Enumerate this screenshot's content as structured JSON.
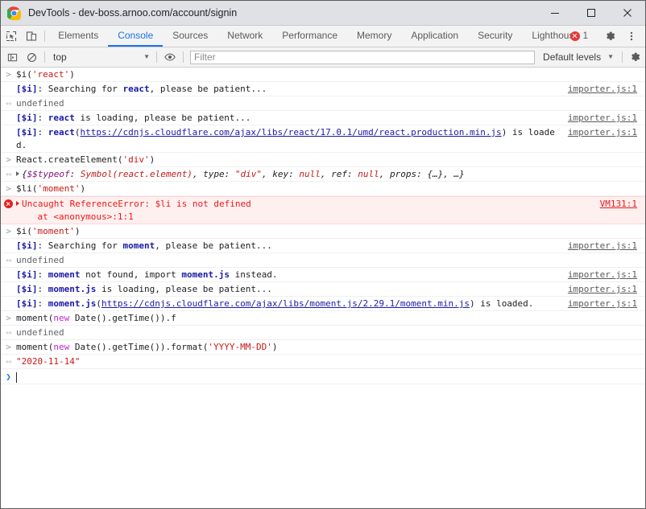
{
  "window": {
    "title": "DevTools - dev-boss.arnoo.com/account/signin",
    "logo_icon": "chrome-logo",
    "controls": [
      {
        "name": "minimize",
        "icon": "minimize-icon"
      },
      {
        "name": "maximize",
        "icon": "maximize-icon"
      },
      {
        "name": "close",
        "icon": "close-icon"
      }
    ]
  },
  "tabbar": {
    "left_icons": [
      {
        "name": "inspect-element-picker",
        "icon": "cursor-select-icon"
      },
      {
        "name": "device-toolbar-toggle",
        "icon": "device-toggle-icon"
      }
    ],
    "tabs": [
      {
        "label": "Elements",
        "active": false
      },
      {
        "label": "Console",
        "active": true
      },
      {
        "label": "Sources",
        "active": false
      },
      {
        "label": "Network",
        "active": false
      },
      {
        "label": "Performance",
        "active": false
      },
      {
        "label": "Memory",
        "active": false
      },
      {
        "label": "Application",
        "active": false
      },
      {
        "label": "Security",
        "active": false
      },
      {
        "label": "Lighthouse",
        "active": false
      }
    ],
    "error_count": "1",
    "error_icon": "error-circle-icon",
    "settings_icon": "gear-icon",
    "more_icon": "more-vertical-icon"
  },
  "console_toolbar": {
    "sidebar_toggle_icon": "console-sidebar-icon",
    "clear_icon": "clear-console-icon",
    "context_value": "top",
    "eye_icon": "live-expression-eye-icon",
    "filter_placeholder": "Filter",
    "filter_value": "",
    "levels_label": "Default levels",
    "settings_icon": "gear-icon"
  },
  "console_rows": [
    {
      "id": "r1",
      "kind": "input",
      "gutter": ">",
      "source": "",
      "tokens": [
        {
          "t": "plain",
          "v": "$i("
        },
        {
          "t": "str",
          "v": "'react'"
        },
        {
          "t": "plain",
          "v": ")"
        }
      ]
    },
    {
      "id": "r2",
      "kind": "log",
      "gutter": "",
      "source": "importer.js:1",
      "tokens": [
        {
          "t": "tag",
          "v": "[$i]"
        },
        {
          "t": "plain",
          "v": ": Searching for "
        },
        {
          "t": "tag",
          "v": "react"
        },
        {
          "t": "plain",
          "v": ", please be patient..."
        }
      ]
    },
    {
      "id": "r3",
      "kind": "output",
      "gutter": "↤",
      "source": "",
      "tokens": [
        {
          "t": "undef",
          "v": "undefined"
        }
      ]
    },
    {
      "id": "r4",
      "kind": "log",
      "gutter": "",
      "source": "importer.js:1",
      "tokens": [
        {
          "t": "tag",
          "v": "[$i]"
        },
        {
          "t": "plain",
          "v": ": "
        },
        {
          "t": "tag",
          "v": "react"
        },
        {
          "t": "plain",
          "v": " is loading, please be patient..."
        }
      ]
    },
    {
      "id": "r5",
      "kind": "log",
      "gutter": "",
      "source": "importer.js:1",
      "tokens": [
        {
          "t": "tag",
          "v": "[$i]"
        },
        {
          "t": "plain",
          "v": ": "
        },
        {
          "t": "tag",
          "v": "react"
        },
        {
          "t": "plain",
          "v": "("
        },
        {
          "t": "link",
          "v": "https://cdnjs.cloudflare.com/ajax/libs/react/17.0.1/umd/react.production.min.js"
        },
        {
          "t": "plain",
          "v": ") is loaded."
        }
      ]
    },
    {
      "id": "r6",
      "kind": "input",
      "gutter": ">",
      "source": "",
      "tokens": [
        {
          "t": "plain",
          "v": "React.createElement("
        },
        {
          "t": "str",
          "v": "'div'"
        },
        {
          "t": "plain",
          "v": ")"
        }
      ]
    },
    {
      "id": "r7",
      "kind": "output",
      "gutter": "↤",
      "source": "",
      "expandable": true,
      "tokens": [
        {
          "t": "objname",
          "v": "{"
        },
        {
          "t": "objkey",
          "v": "$$typeof"
        },
        {
          "t": "objname",
          "v": ": "
        },
        {
          "t": "objval",
          "v": "Symbol(react.element)"
        },
        {
          "t": "objname",
          "v": ", type: "
        },
        {
          "t": "objval",
          "v": "\"div\""
        },
        {
          "t": "objname",
          "v": ", key: "
        },
        {
          "t": "objval",
          "v": "null"
        },
        {
          "t": "objname",
          "v": ", ref: "
        },
        {
          "t": "objval",
          "v": "null"
        },
        {
          "t": "objname",
          "v": ", props: {…}, …}"
        }
      ]
    },
    {
      "id": "r8",
      "kind": "input",
      "gutter": ">",
      "source": "",
      "tokens": [
        {
          "t": "plain",
          "v": "$li("
        },
        {
          "t": "str",
          "v": "'moment'"
        },
        {
          "t": "plain",
          "v": ")"
        }
      ]
    },
    {
      "id": "r9",
      "kind": "error",
      "gutter": "error-icon",
      "source": "VM131:1",
      "expandable": true,
      "text": "Uncaught ReferenceError: $li is not defined",
      "text2": "    at <anonymous>:1:1"
    },
    {
      "id": "r10",
      "kind": "input",
      "gutter": ">",
      "source": "",
      "tokens": [
        {
          "t": "plain",
          "v": "$i("
        },
        {
          "t": "str",
          "v": "'moment'"
        },
        {
          "t": "plain",
          "v": ")"
        }
      ]
    },
    {
      "id": "r11",
      "kind": "log",
      "gutter": "",
      "source": "importer.js:1",
      "tokens": [
        {
          "t": "tag",
          "v": "[$i]"
        },
        {
          "t": "plain",
          "v": ": Searching for "
        },
        {
          "t": "tag",
          "v": "moment"
        },
        {
          "t": "plain",
          "v": ", please be patient..."
        }
      ]
    },
    {
      "id": "r12",
      "kind": "output",
      "gutter": "↤",
      "source": "",
      "tokens": [
        {
          "t": "undef",
          "v": "undefined"
        }
      ]
    },
    {
      "id": "r13",
      "kind": "log",
      "gutter": "",
      "source": "importer.js:1",
      "tokens": [
        {
          "t": "tag",
          "v": "[$i]"
        },
        {
          "t": "plain",
          "v": ": "
        },
        {
          "t": "tag",
          "v": "moment"
        },
        {
          "t": "plain",
          "v": " not found, import "
        },
        {
          "t": "tag",
          "v": "moment.js"
        },
        {
          "t": "plain",
          "v": " instead."
        }
      ]
    },
    {
      "id": "r14",
      "kind": "log",
      "gutter": "",
      "source": "importer.js:1",
      "tokens": [
        {
          "t": "tag",
          "v": "[$i]"
        },
        {
          "t": "plain",
          "v": ": "
        },
        {
          "t": "tag",
          "v": "moment.js"
        },
        {
          "t": "plain",
          "v": " is loading, please be patient..."
        }
      ]
    },
    {
      "id": "r15",
      "kind": "log",
      "gutter": "",
      "source": "importer.js:1",
      "tokens": [
        {
          "t": "tag",
          "v": "[$i]"
        },
        {
          "t": "plain",
          "v": ": "
        },
        {
          "t": "tag",
          "v": "moment.js"
        },
        {
          "t": "plain",
          "v": "("
        },
        {
          "t": "link",
          "v": "https://cdnjs.cloudflare.com/ajax/libs/moment.js/2.29.1/moment.min.js"
        },
        {
          "t": "plain",
          "v": ") is loaded."
        }
      ]
    },
    {
      "id": "r16",
      "kind": "input",
      "gutter": ">",
      "source": "",
      "tokens": [
        {
          "t": "plain",
          "v": "moment("
        },
        {
          "t": "kwnew",
          "v": "new"
        },
        {
          "t": "plain",
          "v": " Date().getTime()).f"
        }
      ]
    },
    {
      "id": "r17",
      "kind": "output",
      "gutter": "↤",
      "source": "",
      "tokens": [
        {
          "t": "undef",
          "v": "undefined"
        }
      ]
    },
    {
      "id": "r18",
      "kind": "input",
      "gutter": ">",
      "source": "",
      "tokens": [
        {
          "t": "plain",
          "v": "moment("
        },
        {
          "t": "kwnew",
          "v": "new"
        },
        {
          "t": "plain",
          "v": " Date().getTime()).format("
        },
        {
          "t": "str",
          "v": "'YYYY-MM-DD'"
        },
        {
          "t": "plain",
          "v": ")"
        }
      ]
    },
    {
      "id": "r19",
      "kind": "output",
      "gutter": "↤",
      "source": "",
      "tokens": [
        {
          "t": "res",
          "v": "\"2020-11-14\""
        }
      ]
    }
  ],
  "prompt": {
    "gutter": "❯",
    "value": ""
  },
  "colors": {
    "accent": "#1a73e8",
    "error": "#f01616",
    "error_bg": "#fff0f0",
    "string": "#c41a16",
    "keyword": "#c026d3",
    "tag_blue": "#1a1aa6",
    "titlebar_bg": "#dfe1e5",
    "toolbar_bg": "#f3f3f3"
  }
}
